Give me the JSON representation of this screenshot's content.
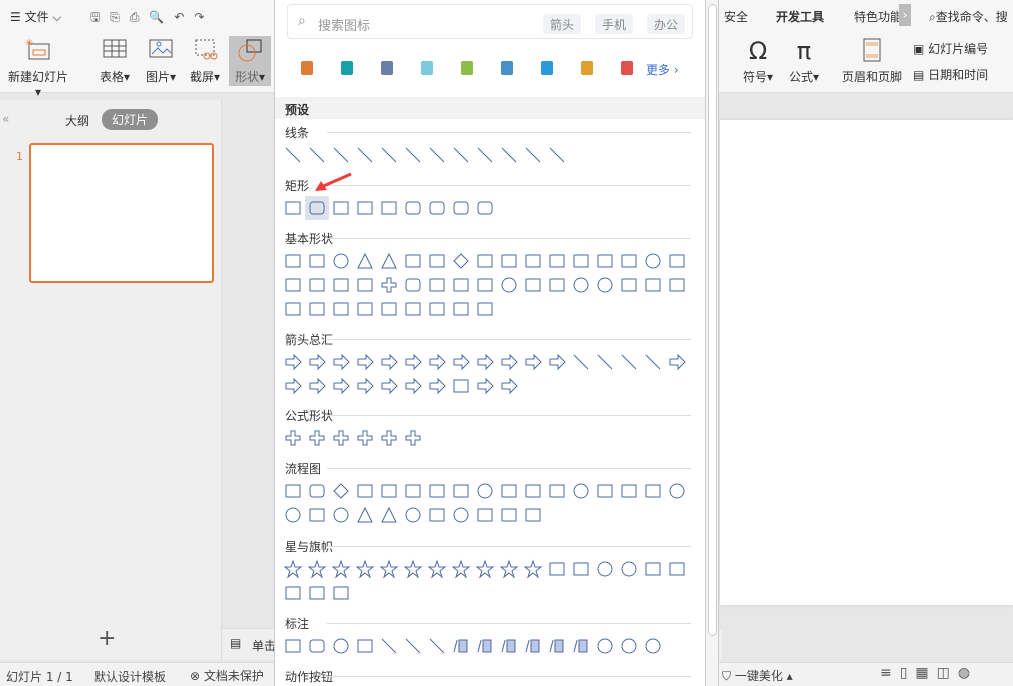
{
  "menu": {
    "file": "文件",
    "tabs_right": [
      "安全",
      "开发工具",
      "特色功能"
    ],
    "search_cmd": "查找命令、搜"
  },
  "ribbon": {
    "new_slide": "新建幻灯片",
    "table": "表格",
    "picture": "图片",
    "screenshot": "截屏",
    "shape": "形状",
    "symbol": "符号",
    "formula": "公式",
    "header_footer": "页眉和页脚",
    "slide_number": "幻灯片编号",
    "date_time": "日期和时间"
  },
  "left": {
    "outline": "大纲",
    "slides": "幻灯片",
    "slide_index": "1"
  },
  "notes": {
    "placeholder": "单击"
  },
  "status": {
    "slide_count": "幻灯片 1 / 1",
    "template": "默认设计模板",
    "protect": "文档未保护",
    "beautify": "一键美化"
  },
  "panel": {
    "search_placeholder": "搜索图标",
    "chips": [
      "箭头",
      "手机",
      "办公"
    ],
    "more": "更多",
    "icon_items": [
      "lamp",
      "house",
      "robot",
      "lock",
      "network",
      "presentation",
      "team",
      "idea",
      "box"
    ],
    "preset": "预设",
    "sections": [
      {
        "title": "线条",
        "rows": [
          [
            "line",
            "arrow-line",
            "double-arrow-line",
            "elbow",
            "elbow-arrow",
            "elbow-double-arrow",
            "curve",
            "curve-arrow",
            "curve-double-arrow",
            "s-curve",
            "freeform",
            "scribble"
          ]
        ]
      },
      {
        "title": "矩形",
        "rows": [
          [
            "rect",
            "roundrect",
            "snip1",
            "snip2",
            "snip-diag",
            "snip-round",
            "round1",
            "round2",
            "round-diag"
          ]
        ]
      },
      {
        "title": "基本形状",
        "rows": [
          [
            "textbox",
            "vtextbox",
            "circle",
            "triangle",
            "rtriangle",
            "parallelogram",
            "trapezoid",
            "diamond",
            "pentagon",
            "hexagon",
            "heptagon",
            "octagon",
            "decagon",
            "dodecagon",
            "pie",
            "chord",
            "teardrop"
          ],
          [
            "frame",
            "halfframe",
            "lshape",
            "diagstripe",
            "plus",
            "plaque",
            "can",
            "cube",
            "bevel",
            "donut",
            "nosign",
            "arc",
            "foldcorner",
            "smiley",
            "heart",
            "lightning",
            "sun"
          ],
          [
            "moon",
            "cloud",
            "arc2",
            "bracketpair",
            "bracepair",
            "lbracket",
            "rbracket",
            "lbrace",
            "rbrace"
          ]
        ]
      },
      {
        "title": "箭头总汇",
        "rows": [
          [
            "right",
            "left",
            "up",
            "down",
            "leftright",
            "updown",
            "quad",
            "leftrightup",
            "bent",
            "uturn",
            "leftup",
            "bentup",
            "curvedright",
            "curvedleft",
            "curvedup",
            "curveddown",
            "striped"
          ],
          [
            "notched",
            "pentagonarrow",
            "chevron",
            "rightcallout",
            "leftcallout",
            "upcallout",
            "downcallout",
            "lrcallout",
            "quadcallout",
            "circular"
          ]
        ]
      },
      {
        "title": "公式形状",
        "rows": [
          [
            "plus",
            "minus",
            "multiply",
            "divide",
            "equal",
            "notequal"
          ]
        ]
      },
      {
        "title": "流程图",
        "rows": [
          [
            "process",
            "alternate",
            "decision",
            "data",
            "predefined",
            "internal",
            "document",
            "multidoc",
            "terminator",
            "preparation",
            "manualinput",
            "manualop",
            "connector",
            "offpage",
            "card",
            "tape",
            "summing"
          ],
          [
            "or",
            "collate",
            "sort",
            "extract",
            "merge",
            "storeddata",
            "delay",
            "seqaccess",
            "magdisk",
            "directaccess",
            "display"
          ]
        ]
      },
      {
        "title": "星与旗帜",
        "rows": [
          [
            "explosion1",
            "star4",
            "star5",
            "star6",
            "star7",
            "star8",
            "star10",
            "star12",
            "star16",
            "star24",
            "star32",
            "ribbon1",
            "ribbon2",
            "ellipseribbon1",
            "ellipseribbon2",
            "scroll1",
            "scroll2"
          ],
          [
            "vscroll",
            "wave",
            "doublewave"
          ]
        ]
      },
      {
        "title": "标注",
        "rows": [
          [
            "rectcallout",
            "roundcallout",
            "ovalcallout",
            "cloudcallout",
            "line1",
            "line2",
            "line3",
            "accent1",
            "accent2",
            "accent3",
            "bar1",
            "bar2",
            "bar3",
            "border1",
            "border2",
            "border3"
          ]
        ]
      },
      {
        "title": "动作按钮",
        "rows": []
      }
    ]
  },
  "colors": {
    "accent": "#e8773a",
    "shape_stroke": "#4a6aa5",
    "arrow": "#f03c3c"
  }
}
